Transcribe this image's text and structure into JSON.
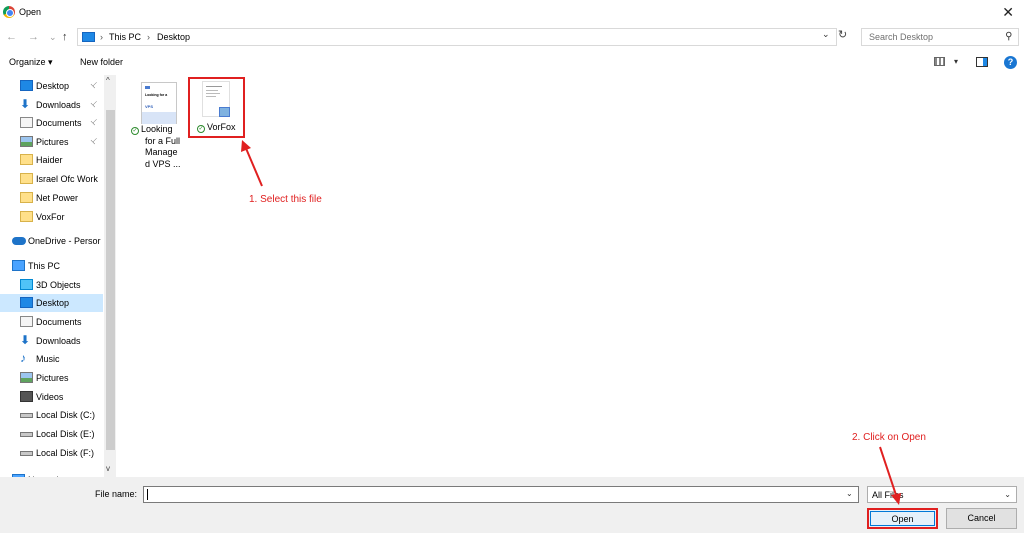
{
  "window": {
    "title": "Open",
    "close_glyph": "✕"
  },
  "nav_buttons": {
    "back": "←",
    "forward": "→",
    "recent": "⌄",
    "up": "↑"
  },
  "address": {
    "crumbs": [
      "This PC",
      "Desktop"
    ],
    "separator": "›",
    "dropdown": "⌄",
    "refresh": "↻"
  },
  "search": {
    "placeholder": "Search Desktop",
    "icon": "⚲"
  },
  "toolbar": {
    "organize": "Organize ▾",
    "new_folder": "New folder",
    "view_dd": "▾",
    "help": "?"
  },
  "nav": [
    {
      "label": "Desktop",
      "icon": "desktop-icon",
      "pinned": true
    },
    {
      "label": "Downloads",
      "icon": "download-icon",
      "pinned": true
    },
    {
      "label": "Documents",
      "icon": "document-icon",
      "pinned": true
    },
    {
      "label": "Pictures",
      "icon": "pictures-icon",
      "pinned": true
    },
    {
      "label": "Haider",
      "icon": "folder-icon",
      "pinned": false
    },
    {
      "label": "Israel Ofc Work",
      "icon": "folder-icon",
      "pinned": false
    },
    {
      "label": "Net Power",
      "icon": "folder-icon",
      "pinned": false
    },
    {
      "label": "VoxFor",
      "icon": "folder-icon",
      "pinned": false
    },
    {
      "label": "OneDrive - Persor",
      "icon": "onedrive-icon",
      "pinned": false
    },
    {
      "label": "This PC",
      "icon": "this-pc-icon",
      "pinned": false
    },
    {
      "label": "3D Objects",
      "icon": "3d-objects-icon",
      "pinned": false
    },
    {
      "label": "Desktop",
      "icon": "desktop-icon",
      "pinned": false,
      "selected": true
    },
    {
      "label": "Documents",
      "icon": "document-icon",
      "pinned": false
    },
    {
      "label": "Downloads",
      "icon": "download-icon",
      "pinned": false
    },
    {
      "label": "Music",
      "icon": "music-icon",
      "pinned": false
    },
    {
      "label": "Pictures",
      "icon": "pictures-icon",
      "pinned": false
    },
    {
      "label": "Videos",
      "icon": "videos-icon",
      "pinned": false
    },
    {
      "label": "Local Disk (C:)",
      "icon": "disk-icon",
      "pinned": false
    },
    {
      "label": "Local Disk (E:)",
      "icon": "disk-icon",
      "pinned": false
    },
    {
      "label": "Local Disk (F:)",
      "icon": "disk-icon",
      "pinned": false
    },
    {
      "label": "Network",
      "icon": "network-icon",
      "pinned": false
    }
  ],
  "pin_glyph": "📌",
  "scroll": {
    "up": "^",
    "down": "v"
  },
  "files": [
    {
      "name": "Looking for a Full Managed VPS ...",
      "lines": [
        "Looking",
        "for a Full",
        "Manage",
        "d VPS ..."
      ],
      "thumb_text": [
        "Looking for a",
        "VPS"
      ]
    },
    {
      "name": "VorFox",
      "lines": [
        "VorFox"
      ]
    }
  ],
  "sync_glyph": "✓",
  "annotations": {
    "select": "1. Select this file",
    "click": "2. Click on Open"
  },
  "filename": {
    "label": "File name:",
    "value": "",
    "dropdown": "⌄"
  },
  "filetype": {
    "value": "All Files",
    "dropdown": "⌄"
  },
  "buttons": {
    "open": "Open",
    "cancel": "Cancel"
  },
  "colors": {
    "accent": "#0078d7",
    "annotation": "#e02020",
    "selected": "#cce8ff"
  }
}
